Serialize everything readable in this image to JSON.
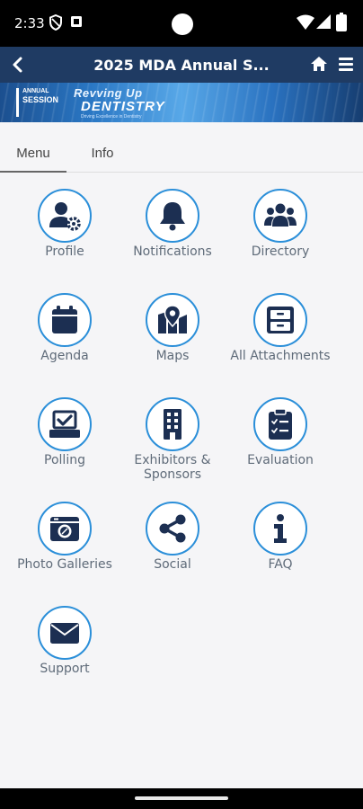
{
  "status_bar": {
    "time": "2:33"
  },
  "app_bar": {
    "title": "2025 MDA Annual S..."
  },
  "banner": {
    "logo_line1": "ANNUAL",
    "logo_line2": "SESSION",
    "script_text": "Revving Up",
    "headline": "DENTISTRY",
    "subtext": "Driving Excellence in Dentistry"
  },
  "tabs": [
    {
      "label": "Menu",
      "active": true
    },
    {
      "label": "Info",
      "active": false
    }
  ],
  "menu_items": [
    {
      "label": "Profile",
      "icon": "profile-gear-icon"
    },
    {
      "label": "Notifications",
      "icon": "bell-icon"
    },
    {
      "label": "Directory",
      "icon": "people-group-icon"
    },
    {
      "label": "Agenda",
      "icon": "calendar-icon"
    },
    {
      "label": "Maps",
      "icon": "map-pin-icon"
    },
    {
      "label": "All Attachments",
      "icon": "file-cabinet-icon"
    },
    {
      "label": "Polling",
      "icon": "ballot-box-icon"
    },
    {
      "label": "Exhibitors & Sponsors",
      "icon": "building-icon"
    },
    {
      "label": "Evaluation",
      "icon": "clipboard-check-icon"
    },
    {
      "label": "Photo Galleries",
      "icon": "camera-icon"
    },
    {
      "label": "Social",
      "icon": "share-icon"
    },
    {
      "label": "FAQ",
      "icon": "info-icon"
    },
    {
      "label": "Support",
      "icon": "envelope-icon"
    }
  ],
  "colors": {
    "app_bar": "#1f3b63",
    "icon_fill": "#1c2f52",
    "circle_border": "#2b8fd9",
    "label": "#5f6b79",
    "background": "#f5f5f7"
  }
}
